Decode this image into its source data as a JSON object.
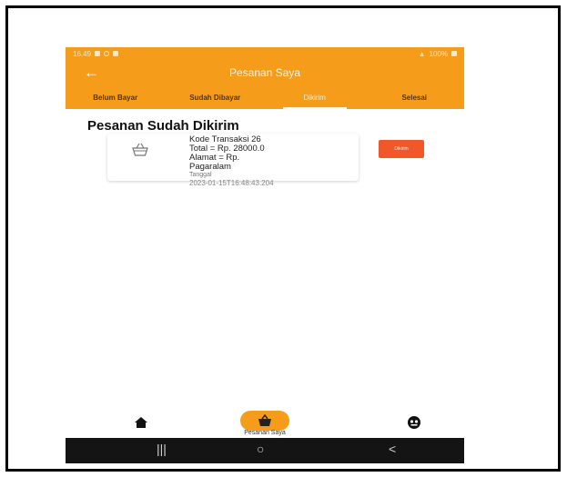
{
  "statusbar": {
    "time": "16.49",
    "battery": "100%"
  },
  "appbar": {
    "title": "Pesanan Saya",
    "back_icon": "arrow-left-icon"
  },
  "tabs": [
    {
      "label": "Belum Bayar",
      "active": false
    },
    {
      "label": "Sudah Dibayar",
      "active": false
    },
    {
      "label": "Dikirim",
      "active": true
    },
    {
      "label": "Selesai",
      "active": false
    }
  ],
  "section": {
    "title": "Pesanan Sudah Dikirim"
  },
  "orders": [
    {
      "icon": "basket-icon",
      "kode": "Kode Transaksi 26",
      "total": "Total = Rp. 28000.0",
      "alamat": "Alamat = Rp.",
      "alamat_value": "Pagaralam",
      "tanggal_label": "Tanggal",
      "tanggal": "2023-01-15T16:48:43.204",
      "status_button": "Dikirim"
    }
  ],
  "bottomnav": {
    "label": "Pesanan Saya"
  },
  "androidnav": {
    "recents": "|||",
    "home": "○",
    "back": "<"
  },
  "colors": {
    "accent": "#f59c1a",
    "button": "#f0582a"
  }
}
